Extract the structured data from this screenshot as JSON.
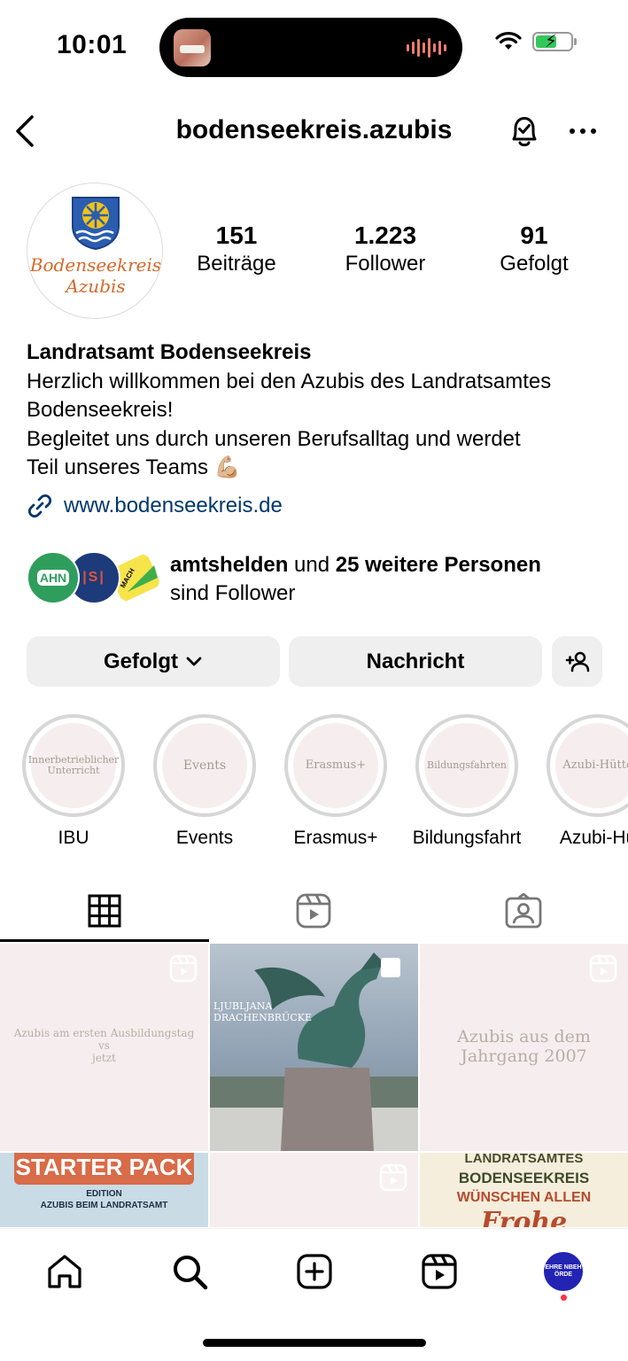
{
  "status_bar": {
    "time": "10:01"
  },
  "header": {
    "username": "bodenseekreis.azubis"
  },
  "profile": {
    "avatar_text_line1": "Bodenseekreis",
    "avatar_text_line2": "Azubis",
    "stats": [
      {
        "value": "151",
        "label": "Beiträge"
      },
      {
        "value": "1.223",
        "label": "Follower"
      },
      {
        "value": "91",
        "label": "Gefolgt"
      }
    ],
    "name": "Landratsamt Bodenseekreis",
    "bio_lines": [
      "Herzlich willkommen bei den Azubis des Landratsamtes",
      "Bodenseekreis!",
      "Begleitet uns durch unseren Berufsalltag und werdet",
      "Teil unseres Teams 💪🏼"
    ],
    "link": "www.bodenseekreis.de"
  },
  "followed_by": {
    "account": "amtshelden",
    "middle": " und ",
    "others": "25 weitere Personen",
    "suffix": "sind Follower",
    "avatars": [
      "AHN",
      "|S|",
      "MACH"
    ]
  },
  "buttons": {
    "following": "Gefolgt",
    "message": "Nachricht"
  },
  "highlights": [
    {
      "label": "IBU",
      "cover": "Innerbetrieblicher Unterricht"
    },
    {
      "label": "Events",
      "cover": "Events"
    },
    {
      "label": "Erasmus+",
      "cover": "Erasmus+"
    },
    {
      "label": "Bildungsfahrt",
      "cover": "Bildungsfahrten"
    },
    {
      "label": "Azubi-Hü",
      "cover": "Azubi-Hütte"
    }
  ],
  "grid": {
    "post1_line1": "Azubis am ersten Ausbildungstag",
    "post1_line2": "vs",
    "post1_line3": "jetzt",
    "post2_line1": "LJUBLJANA",
    "post2_line2": "DRACHENBRÜCKE",
    "post3_line1": "Azubis aus dem",
    "post3_line2": "Jahrgang 2007",
    "post4_title": "STARTER PACK",
    "post4_line1": "EDITION",
    "post4_line2": "AZUBIS BEIM LANDRATSAMT",
    "post6_line1": "LANDRATSAMTES",
    "post6_line2": "BODENSEEKREIS",
    "post6_line3": "WÜNSCHEN ALLEN",
    "post6_line4": "Frohe"
  },
  "bottom_nav": {
    "avatar_text": "EHRE NBEH ÖRDE"
  },
  "colors": {
    "link": "#00376b",
    "accent_avatar": "#2323b4",
    "notification_dot": "#ff3040"
  }
}
